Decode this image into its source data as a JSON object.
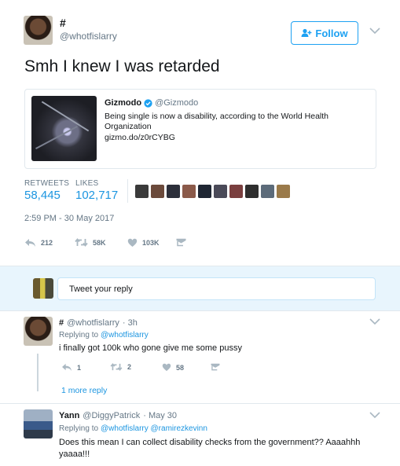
{
  "tweet": {
    "name": "#",
    "handle": "@whotfislarry",
    "follow_label": "Follow",
    "text": "Smh I knew I was retarded",
    "timestamp": "2:59 PM - 30 May 2017",
    "retweets_label": "RETWEETS",
    "retweets_value": "58,445",
    "likes_label": "LIKES",
    "likes_value": "102,717",
    "actions": {
      "reply_count": "212",
      "retweet_count": "58K",
      "like_count": "103K"
    }
  },
  "quoted": {
    "name": "Gizmodo",
    "handle": "@Gizmodo",
    "text": "Being single is now a disability, according to the World Health Organization",
    "link": "gizmo.do/z0rCYBG"
  },
  "reply_composer": {
    "placeholder": "Tweet your reply"
  },
  "replies": [
    {
      "name": "#",
      "handle": "@whotfislarry",
      "time": "· 3h",
      "replying_prefix": "Replying to",
      "replying_to": "@whotfislarry",
      "text": "i finally got 100k who gone give me some pussy",
      "reply_count": "1",
      "retweet_count": "2",
      "like_count": "58",
      "more_label": "1 more reply"
    },
    {
      "name": "Yann",
      "handle": "@DiggyPatrick",
      "time": "· May 30",
      "replying_prefix": "Replying to",
      "replying_to": "@whotfislarry @ramirezkevinn",
      "text": "Does this mean I can collect disability checks from the government?? Aaaahhh yaaaa!!!"
    }
  ],
  "colors": {
    "accent": "#1da1f2",
    "link": "#1b95e0",
    "muted": "#657786",
    "reply_band": "#e8f5fd"
  }
}
